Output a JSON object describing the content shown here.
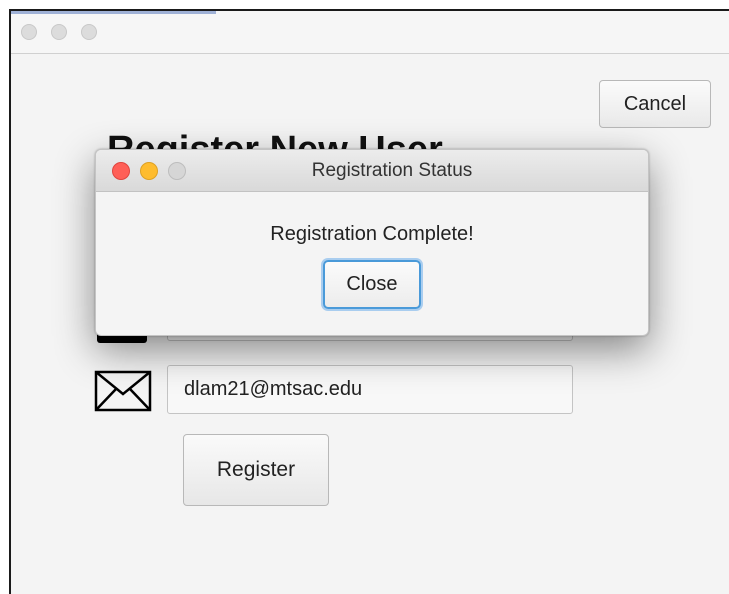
{
  "main_window": {
    "heading": "Register New User",
    "cancel_label": "Cancel",
    "email_value": "dlam21@mtsac.edu",
    "register_label": "Register"
  },
  "dialog": {
    "title": "Registration Status",
    "message": "Registration Complete!",
    "close_label": "Close"
  },
  "icons": {
    "email": "envelope-icon"
  },
  "colors": {
    "dialog_close_light": "#ff5f57",
    "dialog_minimize_light": "#febc2e",
    "focus_ring": "#4a9ad9"
  }
}
